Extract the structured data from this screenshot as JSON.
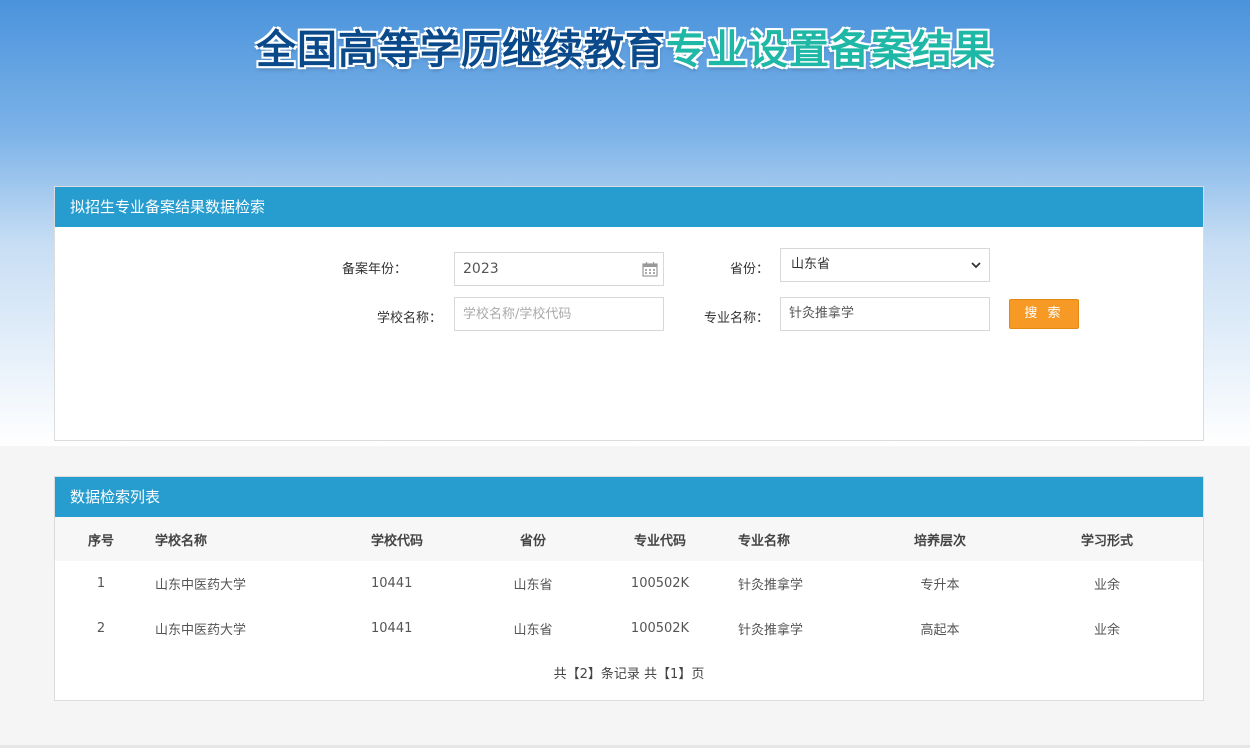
{
  "banner": {
    "title_part1": "全国高等学历继续教育",
    "title_part2": "专业设置备案结果"
  },
  "search_panel": {
    "header": "拟招生专业备案结果数据检索",
    "year_label": "备案年份：",
    "year_value": "2023",
    "province_label": "省份：",
    "province_value": "山东省",
    "school_label": "学校名称：",
    "school_placeholder": "学校名称/学校代码",
    "major_label": "专业名称：",
    "major_value": "针灸推拿学",
    "search_button": "搜 索"
  },
  "result_panel": {
    "header": "数据检索列表",
    "columns": [
      "序号",
      "学校名称",
      "学校代码",
      "省份",
      "专业代码",
      "专业名称",
      "培养层次",
      "学习形式"
    ],
    "rows": [
      [
        "1",
        "山东中医药大学",
        "10441",
        "山东省",
        "100502K",
        "针灸推拿学",
        "专升本",
        "业余"
      ],
      [
        "2",
        "山东中医药大学",
        "10441",
        "山东省",
        "100502K",
        "针灸推拿学",
        "高起本",
        "业余"
      ]
    ],
    "pager": "共【2】条记录 共【1】页"
  },
  "icons": {
    "calendar": "calendar-icon",
    "dropdown": "chevron-down-icon"
  },
  "colors": {
    "panel_header": "#279cce",
    "search_button": "#f79a25",
    "title_dark": "#0b4a8a",
    "title_accent": "#1fb7a6"
  }
}
